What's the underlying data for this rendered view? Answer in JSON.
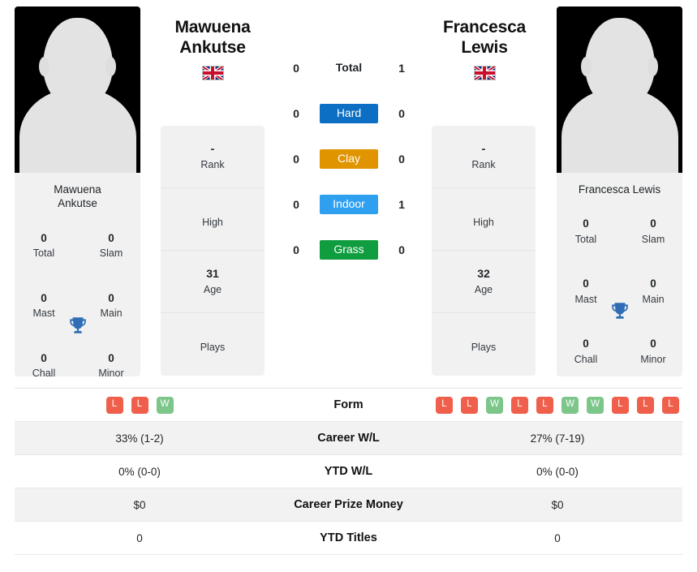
{
  "players": {
    "left": {
      "name_line1": "Mawuena",
      "name_line2": "Ankutse",
      "photo_caption_line1": "Mawuena",
      "photo_caption_line2": "Ankutse",
      "country_flag": "uk-flag-icon",
      "titles": {
        "total_value": "0",
        "total_label": "Total",
        "slam_value": "0",
        "slam_label": "Slam",
        "mast_value": "0",
        "mast_label": "Mast",
        "main_value": "0",
        "main_label": "Main",
        "chall_value": "0",
        "chall_label": "Chall",
        "minor_value": "0",
        "minor_label": "Minor"
      },
      "info": {
        "rank_value": "-",
        "rank_label": "Rank",
        "high_value": "",
        "high_label": "High",
        "age_value": "31",
        "age_label": "Age",
        "plays_value": "",
        "plays_label": "Plays"
      },
      "form": [
        "L",
        "L",
        "W"
      ],
      "career_wl": "33% (1-2)",
      "ytd_wl": "0% (0-0)",
      "career_prize_money": "$0",
      "ytd_titles": "0"
    },
    "right": {
      "name_line1": "Francesca",
      "name_line2": "Lewis",
      "photo_caption_line1": "Francesca Lewis",
      "photo_caption_line2": "",
      "country_flag": "uk-flag-icon",
      "titles": {
        "total_value": "0",
        "total_label": "Total",
        "slam_value": "0",
        "slam_label": "Slam",
        "mast_value": "0",
        "mast_label": "Mast",
        "main_value": "0",
        "main_label": "Main",
        "chall_value": "0",
        "chall_label": "Chall",
        "minor_value": "0",
        "minor_label": "Minor"
      },
      "info": {
        "rank_value": "-",
        "rank_label": "Rank",
        "high_value": "",
        "high_label": "High",
        "age_value": "32",
        "age_label": "Age",
        "plays_value": "",
        "plays_label": "Plays"
      },
      "form": [
        "L",
        "L",
        "W",
        "L",
        "L",
        "W",
        "W",
        "L",
        "L",
        "L"
      ],
      "career_wl": "27% (7-19)",
      "ytd_wl": "0% (0-0)",
      "career_prize_money": "$0",
      "ytd_titles": "0"
    }
  },
  "head_to_head": {
    "rows": [
      {
        "left": "0",
        "label": "Total",
        "right": "1",
        "style": "plain",
        "color": ""
      },
      {
        "left": "0",
        "label": "Hard",
        "right": "0",
        "style": "badge",
        "color": "#0d6fc4"
      },
      {
        "left": "0",
        "label": "Clay",
        "right": "0",
        "style": "badge",
        "color": "#e09400"
      },
      {
        "left": "0",
        "label": "Indoor",
        "right": "1",
        "style": "badge",
        "color": "#2f9ff0"
      },
      {
        "left": "0",
        "label": "Grass",
        "right": "0",
        "style": "badge",
        "color": "#0f9d3f"
      }
    ]
  },
  "stats_table": {
    "rows": [
      {
        "label": "Form",
        "type": "form"
      },
      {
        "label": "Career W/L",
        "type": "text",
        "left_key": "career_wl",
        "right_key": "career_wl"
      },
      {
        "label": "YTD W/L",
        "type": "text",
        "left_key": "ytd_wl",
        "right_key": "ytd_wl"
      },
      {
        "label": "Career Prize Money",
        "type": "text",
        "left_key": "career_prize_money",
        "right_key": "career_prize_money"
      },
      {
        "label": "YTD Titles",
        "type": "text",
        "left_key": "ytd_titles",
        "right_key": "ytd_titles"
      }
    ]
  },
  "colors": {
    "hard": "#0d6fc4",
    "clay": "#e09400",
    "indoor": "#2f9ff0",
    "grass": "#0f9d3f",
    "win_badge": "#7cc68a",
    "loss_badge": "#ef5f4c",
    "trophy": "#2f6db5",
    "card_bg": "#f1f1f1"
  }
}
